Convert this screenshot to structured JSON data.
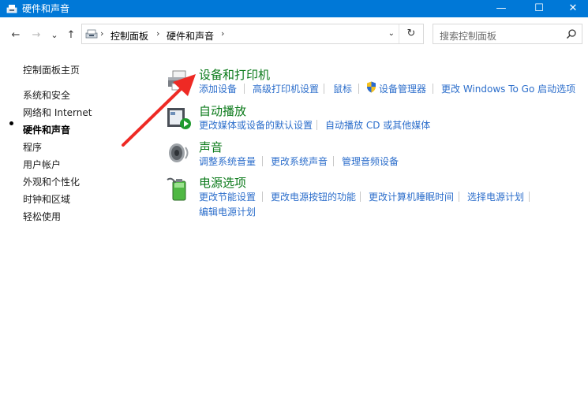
{
  "window": {
    "title": "硬件和声音",
    "minimize": "—",
    "maximize": "☐",
    "close": "✕"
  },
  "nav": {
    "back": "←",
    "forward": "→",
    "recent": "⌄",
    "up": "↑"
  },
  "address": {
    "breadcrumb": [
      "控制面板",
      "硬件和声音"
    ],
    "separator": "›",
    "dropdown": "⌄",
    "refresh": "↻"
  },
  "search": {
    "placeholder": "搜索控制面板"
  },
  "sidebar": {
    "items": [
      {
        "label": "控制面板主页"
      },
      {
        "label": "系统和安全"
      },
      {
        "label": "网络和 Internet"
      },
      {
        "label": "硬件和声音",
        "active": true
      },
      {
        "label": "程序"
      },
      {
        "label": "用户帐户"
      },
      {
        "label": "外观和个性化"
      },
      {
        "label": "时钟和区域"
      },
      {
        "label": "轻松使用"
      }
    ]
  },
  "categories": [
    {
      "title": "设备和打印机",
      "icon": "printer-icon",
      "links": [
        "添加设备",
        "高级打印机设置",
        "鼠标",
        "设备管理器",
        "更改 Windows To Go 启动选项"
      ]
    },
    {
      "title": "自动播放",
      "icon": "autoplay-icon",
      "links": [
        "更改媒体或设备的默认设置",
        "自动播放 CD 或其他媒体"
      ]
    },
    {
      "title": "声音",
      "icon": "speaker-icon",
      "links": [
        "调整系统音量",
        "更改系统声音",
        "管理音频设备"
      ]
    },
    {
      "title": "电源选项",
      "icon": "battery-icon",
      "links": [
        "更改节能设置",
        "更改电源按钮的功能",
        "更改计算机睡眠时间",
        "选择电源计划",
        "编辑电源计划"
      ]
    }
  ],
  "colors": {
    "titlebar": "#0078d7",
    "category_title": "#0b7a1a",
    "link": "#2c6ecb",
    "annotation_arrow": "#ee2a24"
  }
}
